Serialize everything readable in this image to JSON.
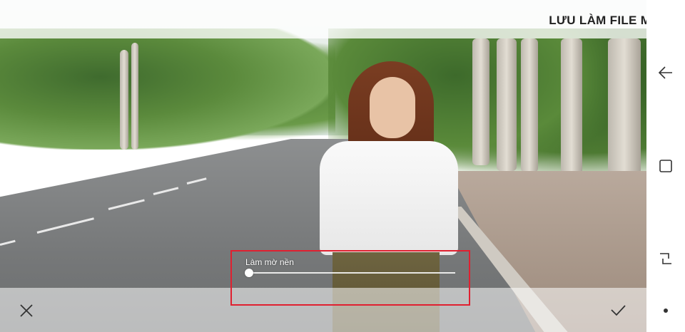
{
  "editor": {
    "save_as_new_label": "LƯU LÀM FILE MỚI",
    "blur_label": "Làm mờ nền",
    "blur_level": 0.0,
    "highlight_color": "#e02030"
  },
  "toolbar": {
    "cancel_icon": "close-icon",
    "confirm_icon": "checkmark-icon"
  },
  "navigation": {
    "back_icon": "back-arrow-icon",
    "home_icon": "home-square-icon",
    "recents_icon": "recent-apps-icon",
    "dot_icon": "dot-icon"
  }
}
